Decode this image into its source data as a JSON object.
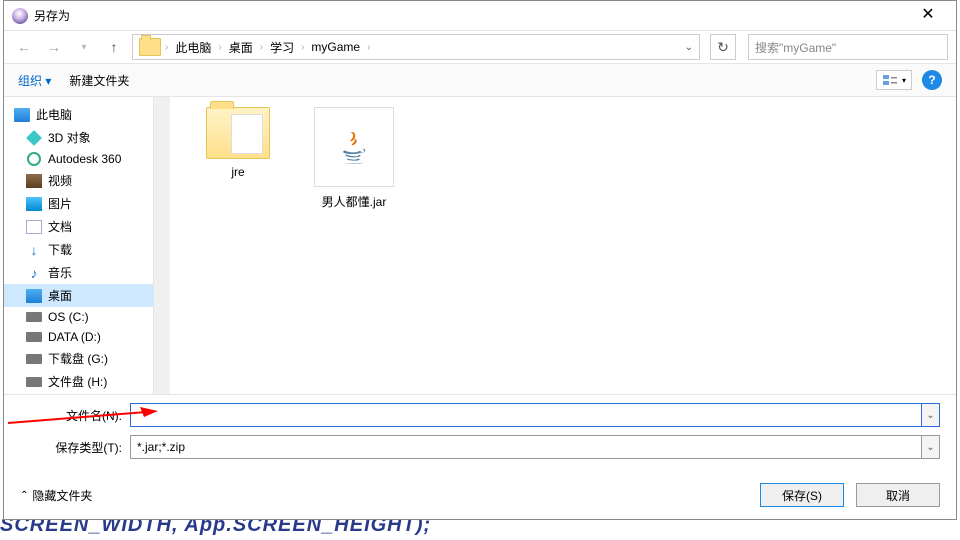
{
  "titlebar": {
    "title": "另存为"
  },
  "breadcrumb": {
    "items": [
      "此电脑",
      "桌面",
      "学习",
      "myGame"
    ]
  },
  "search": {
    "placeholder": "搜索\"myGame\""
  },
  "orgbar": {
    "organize": "组织 ▾",
    "newfolder": "新建文件夹"
  },
  "sidebar": {
    "root": "此电脑",
    "items": [
      {
        "label": "3D 对象",
        "ico": "cube"
      },
      {
        "label": "Autodesk 360",
        "ico": "a360"
      },
      {
        "label": "视频",
        "ico": "vid"
      },
      {
        "label": "图片",
        "ico": "img"
      },
      {
        "label": "文档",
        "ico": "doc"
      },
      {
        "label": "下载",
        "ico": "dl",
        "glyph": "↓"
      },
      {
        "label": "音乐",
        "ico": "mus",
        "glyph": "♪"
      },
      {
        "label": "桌面",
        "ico": "pc",
        "selected": true
      },
      {
        "label": "OS (C:)",
        "ico": "disk"
      },
      {
        "label": "DATA (D:)",
        "ico": "disk"
      },
      {
        "label": "下载盘 (G:)",
        "ico": "disk"
      },
      {
        "label": "文件盘 (H:)",
        "ico": "disk"
      }
    ]
  },
  "files": {
    "folder": "jre",
    "jar": "男人都懂.jar"
  },
  "fields": {
    "name_label": "文件名(N):",
    "name_value": "",
    "type_label": "保存类型(T):",
    "type_value": "*.jar;*.zip"
  },
  "footer": {
    "hide": "隐藏文件夹",
    "save": "保存(S)",
    "cancel": "取消"
  },
  "behind": "SCREEN_WIDTH, App.SCREEN_HEIGHT);"
}
